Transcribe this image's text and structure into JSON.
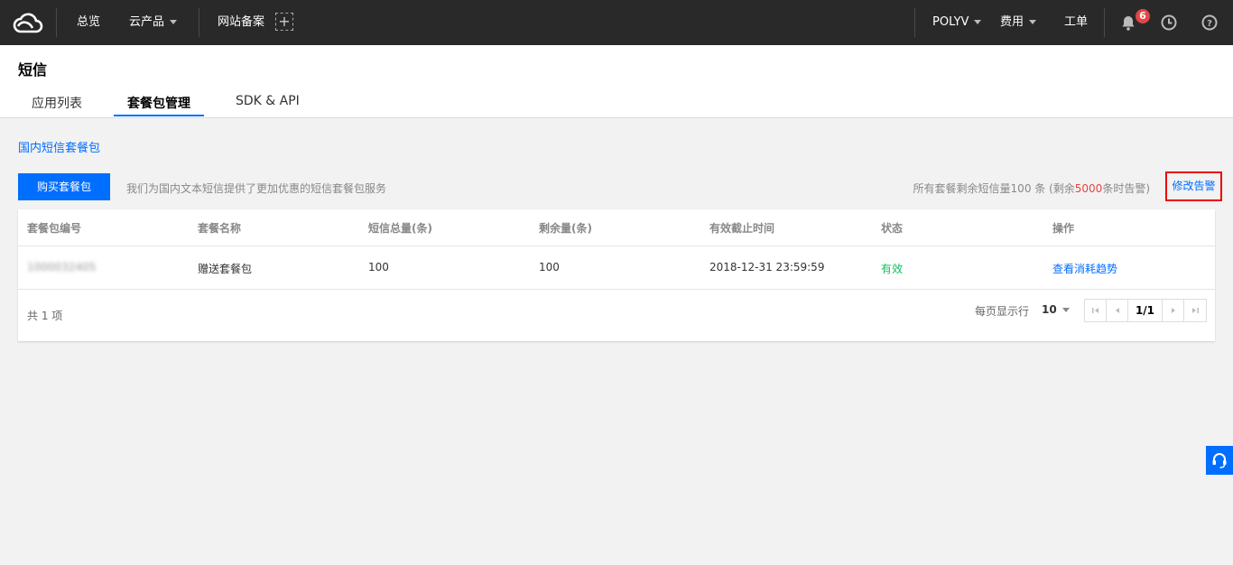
{
  "topnav": {
    "overview": "总览",
    "products": "云产品",
    "icp": "网站备案",
    "account": "POLYV",
    "billing": "费用",
    "tickets": "工单",
    "notification_count": "6"
  },
  "header": {
    "title": "短信",
    "tabs": [
      {
        "label": "应用列表",
        "active": false
      },
      {
        "label": "套餐包管理",
        "active": true
      },
      {
        "label": "SDK & API",
        "active": false
      }
    ]
  },
  "section": {
    "title": "国内短信套餐包",
    "buy_button": "购买套餐包",
    "description": "我们为国内文本短信提供了更加优惠的短信套餐包服务",
    "remain_prefix": "所有套餐剩余短信量100 条 (剩余",
    "remain_threshold": "5000",
    "remain_suffix": "条时告警)",
    "modify_alert": "修改告警"
  },
  "table": {
    "headers": [
      "套餐包编号",
      "套餐名称",
      "短信总量(条)",
      "剩余量(条)",
      "有效截止时间",
      "状态",
      "操作"
    ],
    "rows": [
      {
        "id": "1000032405",
        "name": "赠送套餐包",
        "total": "100",
        "remaining": "100",
        "expires": "2018-12-31 23:59:59",
        "status": "有效",
        "action": "查看消耗趋势"
      }
    ],
    "total_text": "共 1 项",
    "per_page_label": "每页显示行",
    "page_size": "10",
    "page_indicator": "1/1"
  },
  "colors": {
    "primary": "#006eff",
    "topbar": "#292929",
    "success": "#0abf5b",
    "danger": "#e54545"
  }
}
